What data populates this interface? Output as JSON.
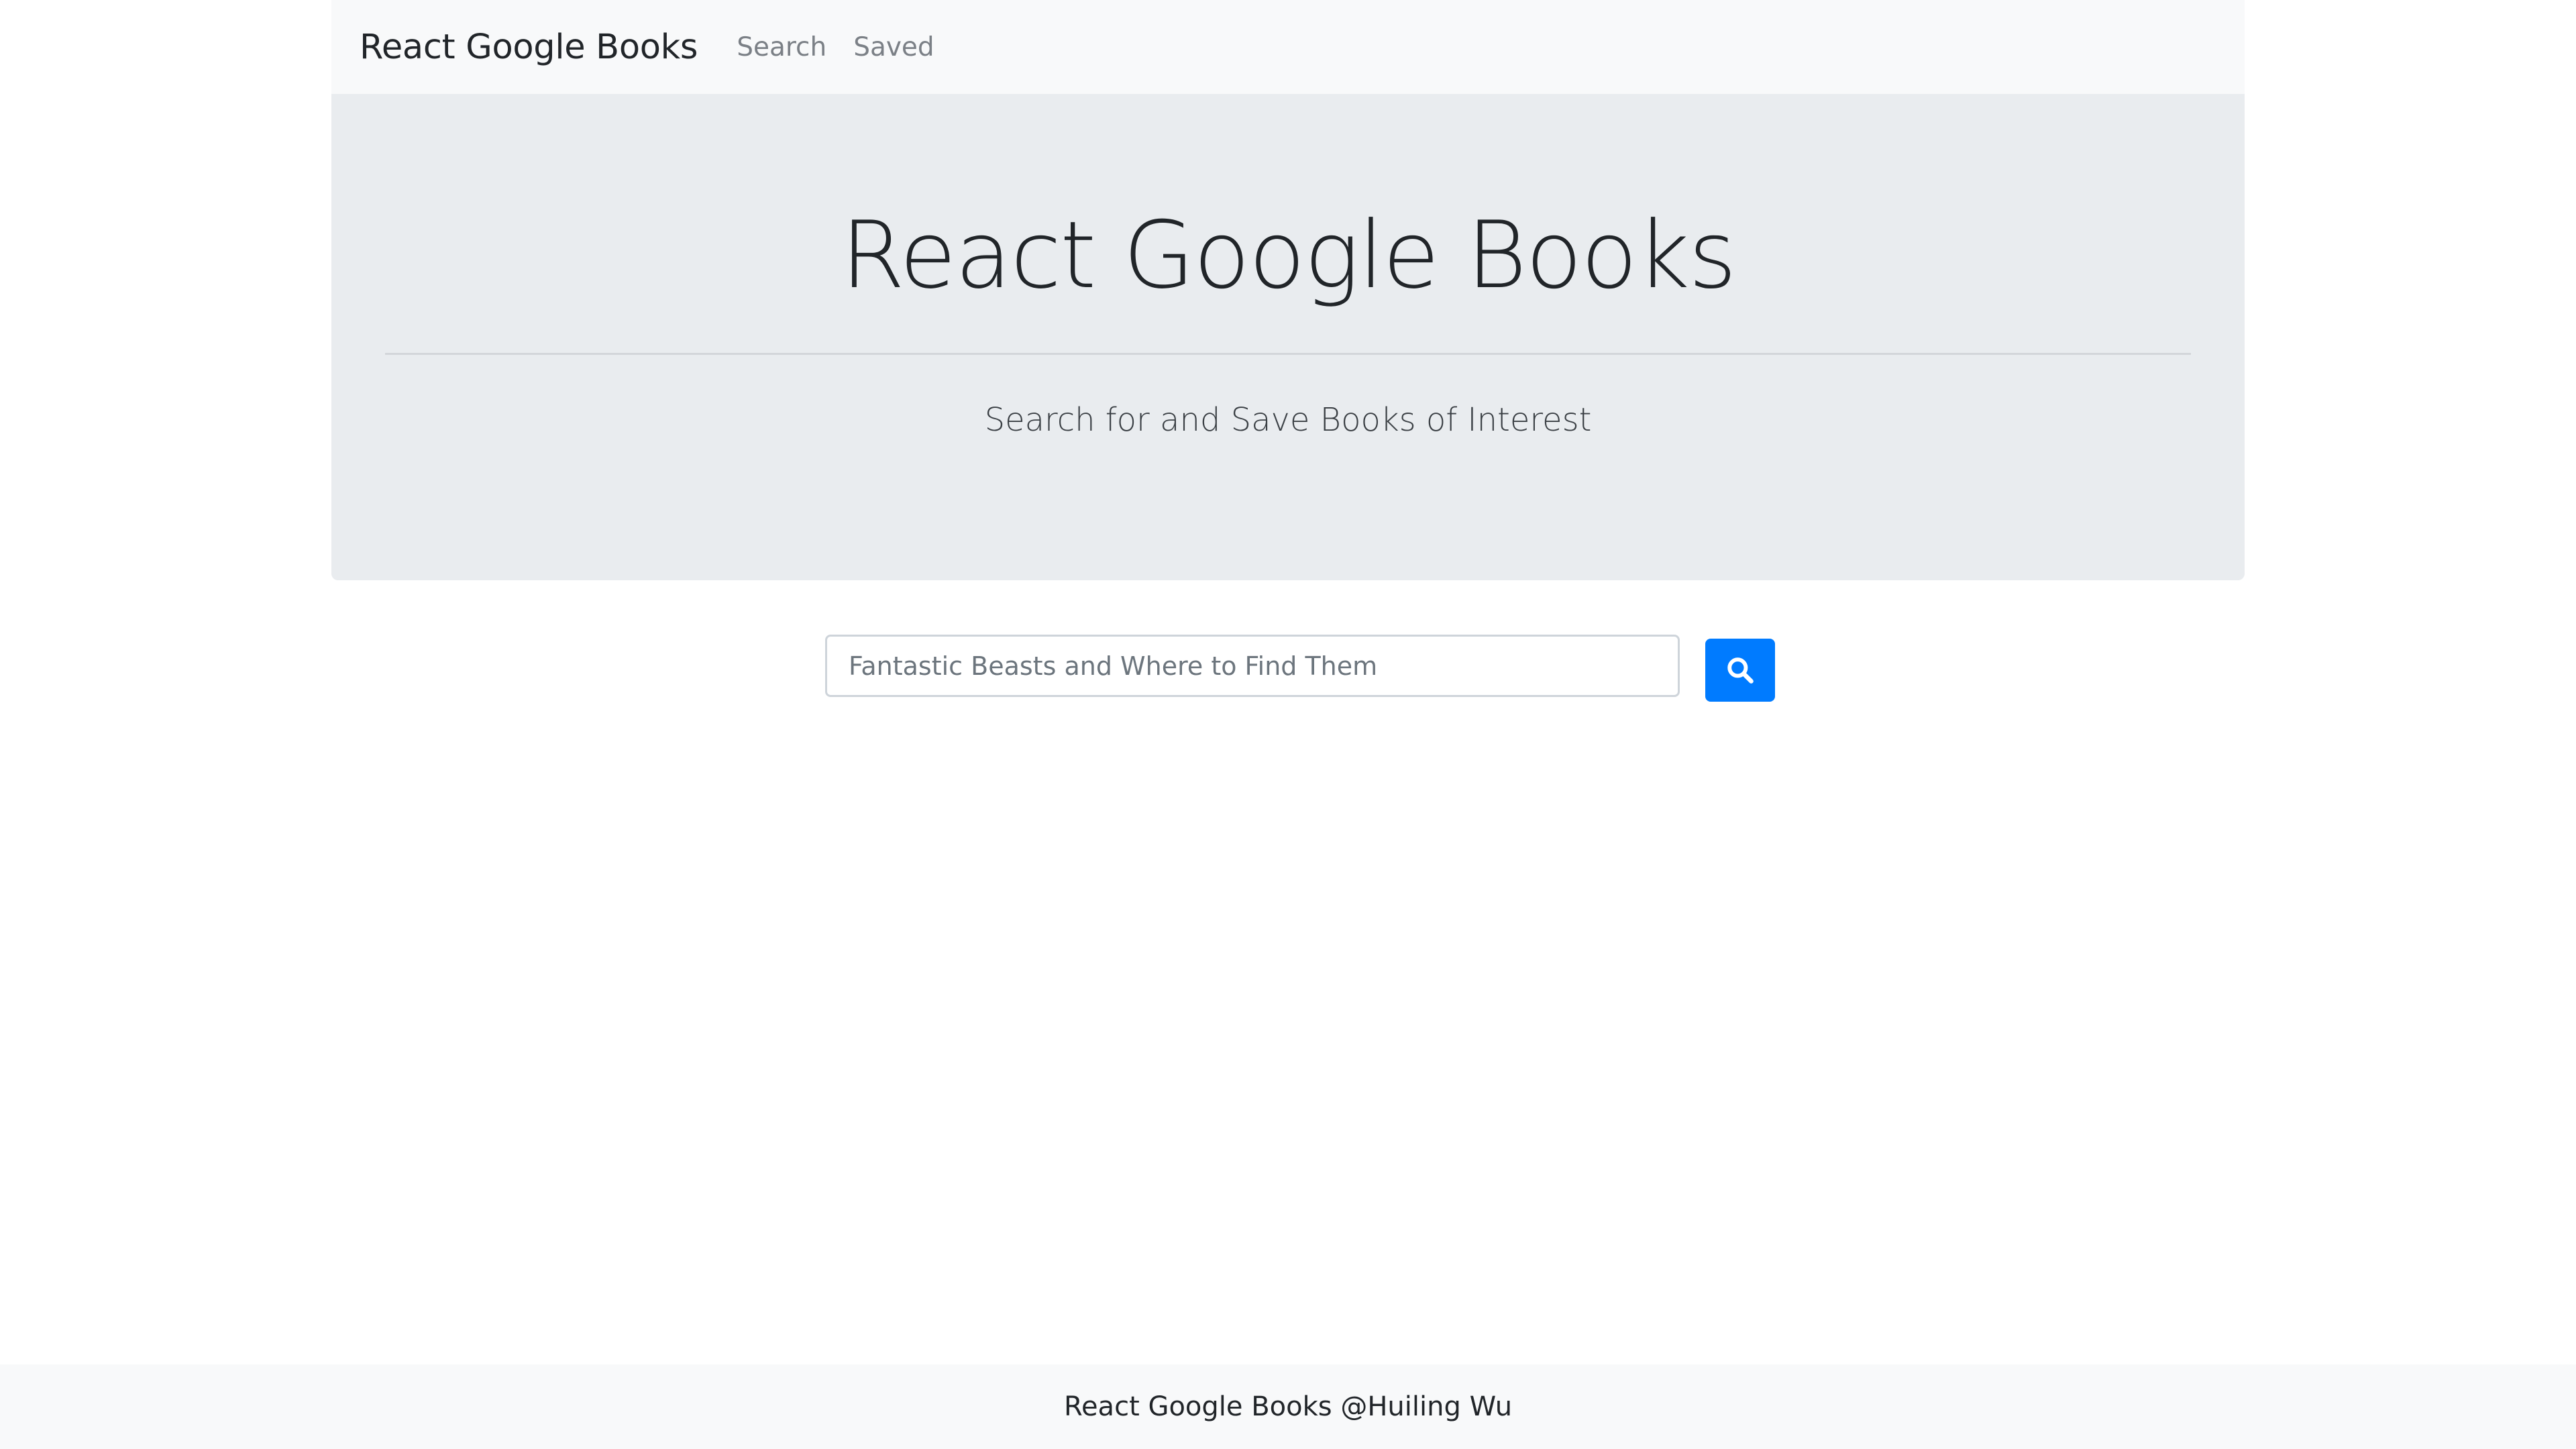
{
  "navbar": {
    "brand": "React Google Books",
    "links": [
      {
        "label": "Search"
      },
      {
        "label": "Saved"
      }
    ]
  },
  "jumbotron": {
    "title": "React Google Books",
    "subtitle": "Search for and Save Books of Interest"
  },
  "search": {
    "value": "",
    "placeholder": "Fantastic Beasts and Where to Find Them",
    "button_icon": "search-icon"
  },
  "footer": {
    "text": "React Google Books @Huiling Wu"
  },
  "colors": {
    "navbar_bg": "#f8f9fa",
    "jumbotron_bg": "#e9ecef",
    "primary": "#007bff",
    "text": "#212529",
    "nav_link": "#7b8086"
  }
}
